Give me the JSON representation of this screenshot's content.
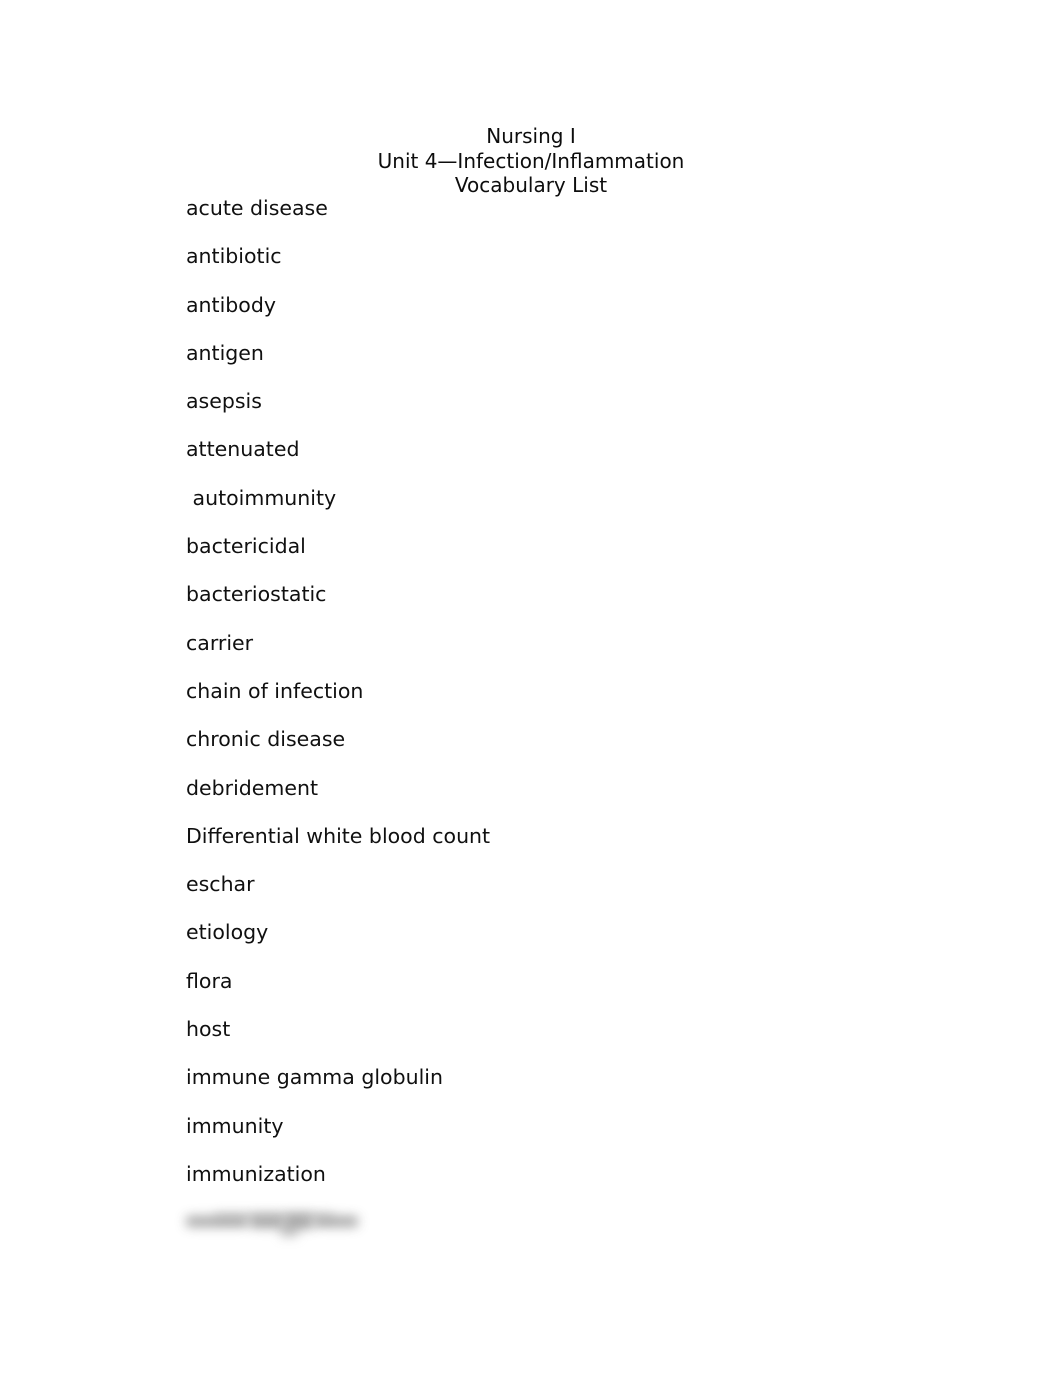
{
  "document": {
    "title_lines": [
      "Nursing I",
      "Unit 4—Infection/Inflammation",
      "Vocabulary List"
    ],
    "vocabulary": [
      "acute disease",
      "antibiotic",
      "antibody",
      "antigen",
      "asepsis",
      "attenuated",
      " autoimmunity",
      "bactericidal",
      "bacteriostatic",
      "carrier",
      "chain of infection",
      "chronic disease",
      "debridement",
      "Differential white blood count",
      "eschar",
      "etiology",
      "flora",
      "host",
      "immune gamma globulin",
      "immunity",
      "immunization",
      ""
    ],
    "colors": {
      "page_background": "#ffffff",
      "text": "#101010",
      "redaction": "#9e9e9e"
    }
  }
}
